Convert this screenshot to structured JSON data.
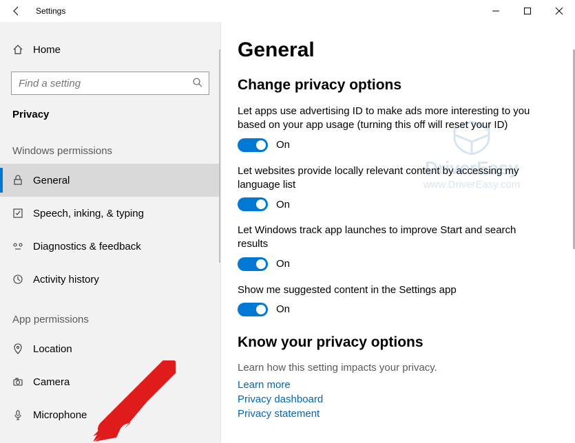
{
  "window": {
    "title": "Settings"
  },
  "sidebar": {
    "home": "Home",
    "search_placeholder": "Find a setting",
    "current_section": "Privacy",
    "group_windows": "Windows permissions",
    "items_windows": [
      {
        "label": "General",
        "selected": true
      },
      {
        "label": "Speech, inking, & typing",
        "selected": false
      },
      {
        "label": "Diagnostics & feedback",
        "selected": false
      },
      {
        "label": "Activity history",
        "selected": false
      }
    ],
    "group_app": "App permissions",
    "items_app": [
      {
        "label": "Location"
      },
      {
        "label": "Camera"
      },
      {
        "label": "Microphone"
      }
    ]
  },
  "content": {
    "page_title": "General",
    "section1_title": "Change privacy options",
    "options": [
      {
        "desc": "Let apps use advertising ID to make ads more interesting to you based on your app usage (turning this off will reset your ID)",
        "state": "On"
      },
      {
        "desc": "Let websites provide locally relevant content by accessing my language list",
        "state": "On"
      },
      {
        "desc": "Let Windows track app launches to improve Start and search results",
        "state": "On"
      },
      {
        "desc": "Show me suggested content in the Settings app",
        "state": "On"
      }
    ],
    "section2_title": "Know your privacy options",
    "section2_desc": "Learn how this setting impacts your privacy.",
    "links": [
      "Learn more",
      "Privacy dashboard",
      "Privacy statement"
    ]
  },
  "watermark": {
    "brand": "DriverEasy",
    "url": "www.DriverEasy.com"
  }
}
